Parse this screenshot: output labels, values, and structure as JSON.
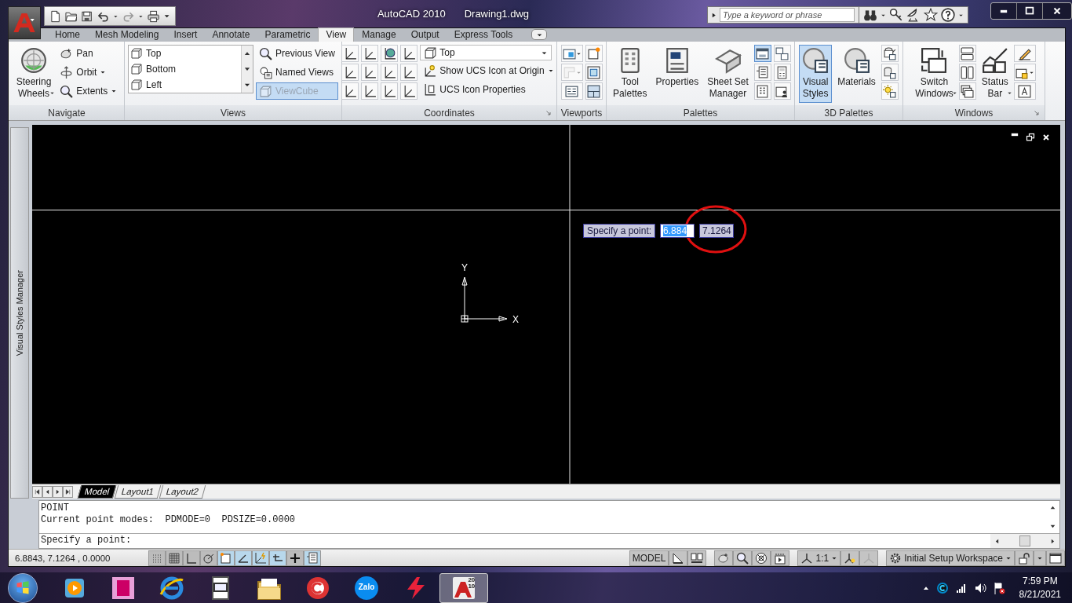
{
  "title_bar": {
    "app_name": "AutoCAD 2010",
    "document": "Drawing1.dwg",
    "search": {
      "placeholder": "Type a keyword or phrase"
    }
  },
  "ribbon_tabs": [
    {
      "label": "Home",
      "selected": false
    },
    {
      "label": "Mesh Modeling",
      "selected": false
    },
    {
      "label": "Insert",
      "selected": false
    },
    {
      "label": "Annotate",
      "selected": false
    },
    {
      "label": "Parametric",
      "selected": false
    },
    {
      "label": "View",
      "selected": true
    },
    {
      "label": "Manage",
      "selected": false
    },
    {
      "label": "Output",
      "selected": false
    },
    {
      "label": "Express Tools",
      "selected": false
    }
  ],
  "ribbon_panels": [
    {
      "title": "Navigate",
      "launcher": false,
      "columns": [
        [
          {
            "kind": "large",
            "label_lines": [
              "Steering",
              "Wheels"
            ],
            "dropdown": true,
            "on": false,
            "disabled": false
          }
        ],
        [
          {
            "kind": "small",
            "label": "Pan",
            "dropdown": false,
            "on": false,
            "disabled": false
          },
          {
            "kind": "small",
            "label": "Orbit",
            "dropdown": true,
            "on": false,
            "disabled": false
          },
          {
            "kind": "small",
            "label": "Extents",
            "dropdown": true,
            "on": false,
            "disabled": false
          }
        ]
      ]
    },
    {
      "title": "Views",
      "launcher": false,
      "columns": [
        [
          {
            "kind": "list",
            "items": [
              "Top",
              "Bottom",
              "Left"
            ]
          }
        ],
        [
          {
            "kind": "small",
            "label": "Previous View",
            "dropdown": false,
            "on": false,
            "disabled": false
          },
          {
            "kind": "small",
            "label": "Named Views",
            "dropdown": false,
            "on": false,
            "disabled": false
          },
          {
            "kind": "small",
            "label": "ViewCube",
            "dropdown": false,
            "on": true,
            "disabled": true
          }
        ]
      ]
    },
    {
      "title": "Coordinates",
      "launcher": true,
      "columns": [
        [
          {
            "kind": "icon",
            "dropdown": false,
            "on": false,
            "disabled": false
          },
          {
            "kind": "icon",
            "dropdown": false,
            "on": false,
            "disabled": false
          },
          {
            "kind": "icon",
            "dropdown": false,
            "on": false,
            "disabled": false
          }
        ],
        [
          {
            "kind": "icon",
            "dropdown": false,
            "on": false,
            "disabled": false
          },
          {
            "kind": "icon",
            "dropdown": false,
            "on": false,
            "disabled": false
          },
          {
            "kind": "icon",
            "dropdown": false,
            "on": false,
            "disabled": false
          }
        ],
        [
          {
            "kind": "icon",
            "dropdown": false,
            "on": false,
            "disabled": false
          },
          {
            "kind": "icon",
            "dropdown": false,
            "on": false,
            "disabled": false
          },
          {
            "kind": "icon",
            "dropdown": false,
            "on": false,
            "disabled": false
          }
        ],
        [
          {
            "kind": "icon",
            "dropdown": false,
            "on": false,
            "disabled": false
          },
          {
            "kind": "icon",
            "dropdown": false,
            "on": false,
            "disabled": false
          },
          {
            "kind": "icon",
            "dropdown": false,
            "on": false,
            "disabled": false
          }
        ],
        [
          {
            "kind": "combo",
            "value": "Top"
          },
          {
            "kind": "small",
            "label": "Show UCS Icon at Origin",
            "dropdown": true,
            "on": false,
            "disabled": false
          },
          {
            "kind": "small",
            "label": "UCS Icon Properties",
            "dropdown": false,
            "on": false,
            "disabled": false
          }
        ]
      ]
    },
    {
      "title": "Viewports",
      "launcher": false,
      "columns": [
        [
          {
            "kind": "icon",
            "dropdown": true,
            "on": false,
            "disabled": false
          },
          {
            "kind": "icon",
            "dropdown": true,
            "on": false,
            "disabled": true
          },
          {
            "kind": "icon",
            "dropdown": false,
            "on": false,
            "disabled": false
          }
        ],
        [
          {
            "kind": "icon",
            "dropdown": false,
            "on": false,
            "disabled": false
          },
          {
            "kind": "icon",
            "dropdown": false,
            "on": false,
            "disabled": false
          },
          {
            "kind": "icon",
            "dropdown": false,
            "on": false,
            "disabled": false
          }
        ]
      ]
    },
    {
      "title": "Palettes",
      "launcher": false,
      "columns": [
        [
          {
            "kind": "large",
            "label_lines": [
              "Tool",
              "Palettes"
            ],
            "dropdown": false,
            "on": false,
            "disabled": false
          }
        ],
        [
          {
            "kind": "large",
            "label_lines": [
              "Properties"
            ],
            "dropdown": false,
            "on": false,
            "disabled": false
          }
        ],
        [
          {
            "kind": "large",
            "label_lines": [
              "Sheet Set",
              "Manager"
            ],
            "dropdown": false,
            "on": false,
            "disabled": false
          }
        ],
        [
          {
            "kind": "icon",
            "dropdown": false,
            "on": true,
            "disabled": false
          },
          {
            "kind": "icon",
            "dropdown": false,
            "on": false,
            "disabled": false
          },
          {
            "kind": "icon",
            "dropdown": false,
            "on": false,
            "disabled": false
          }
        ],
        [
          {
            "kind": "icon",
            "dropdown": false,
            "on": false,
            "disabled": false
          },
          {
            "kind": "icon",
            "dropdown": false,
            "on": false,
            "disabled": false
          },
          {
            "kind": "icon",
            "dropdown": false,
            "on": false,
            "disabled": false
          }
        ]
      ]
    },
    {
      "title": "3D Palettes",
      "launcher": false,
      "columns": [
        [
          {
            "kind": "large",
            "label_lines": [
              "Visual",
              "Styles"
            ],
            "dropdown": false,
            "on": true,
            "disabled": false
          }
        ],
        [
          {
            "kind": "large",
            "label_lines": [
              "Materials"
            ],
            "dropdown": false,
            "on": false,
            "disabled": false
          }
        ],
        [
          {
            "kind": "icon",
            "dropdown": false,
            "on": false,
            "disabled": false
          },
          {
            "kind": "icon",
            "dropdown": false,
            "on": false,
            "disabled": false
          },
          {
            "kind": "icon",
            "dropdown": false,
            "on": false,
            "disabled": false
          }
        ]
      ]
    },
    {
      "title": "Windows",
      "launcher": true,
      "columns": [
        [
          {
            "kind": "large",
            "label_lines": [
              "Switch",
              "Windows"
            ],
            "dropdown": true,
            "on": false,
            "disabled": false
          }
        ],
        [
          {
            "kind": "icon",
            "dropdown": false,
            "on": false,
            "disabled": false
          },
          {
            "kind": "icon",
            "dropdown": false,
            "on": false,
            "disabled": false
          },
          {
            "kind": "icon",
            "dropdown": false,
            "on": false,
            "disabled": false
          }
        ],
        [
          {
            "kind": "large",
            "label_lines": [
              "Status",
              "Bar"
            ],
            "dropdown": true,
            "on": false,
            "disabled": false
          }
        ],
        [
          {
            "kind": "icon",
            "dropdown": false,
            "on": false,
            "disabled": false
          },
          {
            "kind": "icon",
            "dropdown": true,
            "on": false,
            "disabled": false
          },
          {
            "kind": "icon",
            "dropdown": false,
            "on": false,
            "disabled": false
          }
        ]
      ]
    }
  ],
  "side_palette": {
    "title": "Visual Styles Manager"
  },
  "canvas": {
    "ucs": {
      "y_label": "Y",
      "x_label": "X"
    },
    "dynamic_input": {
      "prompt": "Specify a point:",
      "x_value": "6.884",
      "x_selected": true,
      "y_value": "7.1264"
    }
  },
  "layout_tabs": [
    {
      "label": "Model",
      "selected": true
    },
    {
      "label": "Layout1",
      "selected": false
    },
    {
      "label": "Layout2",
      "selected": false
    }
  ],
  "command_line": {
    "history": [
      "POINT",
      "Current point modes:  PDMODE=0  PDSIZE=0.0000"
    ],
    "prompt": "Specify a point:"
  },
  "status_bar": {
    "coordinates": "6.8843, 7.1264 , 0.0000",
    "toggles": [
      {
        "on": false
      },
      {
        "on": false
      },
      {
        "on": false
      },
      {
        "on": false
      },
      {
        "on": true
      },
      {
        "on": true
      },
      {
        "on": true
      },
      {
        "on": true
      },
      {
        "on": false
      },
      {
        "on": true
      }
    ],
    "space": "MODEL",
    "annotation_scale": "1:1",
    "workspace": "Initial Setup Workspace"
  },
  "taskbar": {
    "apps": [
      {
        "active": false
      },
      {
        "active": false
      },
      {
        "active": false
      },
      {
        "active": false
      },
      {
        "active": false
      },
      {
        "active": false
      },
      {
        "active": false,
        "label": "Zalo"
      },
      {
        "active": false
      },
      {
        "active": true,
        "label": "2010"
      }
    ],
    "clock": {
      "time": "7:59 PM",
      "date": "8/21/2021"
    }
  }
}
